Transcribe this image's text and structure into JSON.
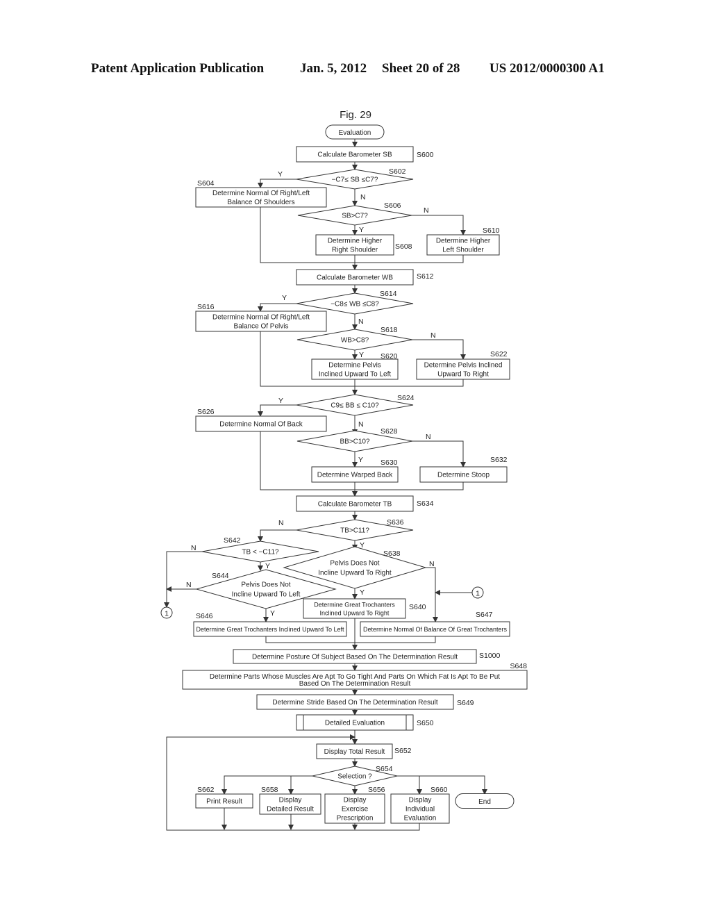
{
  "header": {
    "publication": "Patent Application Publication",
    "date": "Jan. 5, 2012",
    "sheet": "Sheet 20 of 28",
    "number": "US 2012/0000300 A1"
  },
  "figure": {
    "title": "Fig. 29",
    "start": "Evaluation",
    "end": "End",
    "connector": "1",
    "branch": {
      "yes": "Y",
      "no": "N"
    },
    "steps": {
      "S600": {
        "id": "S600",
        "lines": [
          "Calculate Barometer SB"
        ]
      },
      "S602": {
        "id": "S602",
        "lines": [
          "−C7≤ SB ≤C7?"
        ]
      },
      "S604": {
        "id": "S604",
        "lines": [
          "Determine Normal Of Right/Left",
          "Balance Of Shoulders"
        ]
      },
      "S606": {
        "id": "S606",
        "lines": [
          "SB>C7?"
        ]
      },
      "S608": {
        "id": "S608",
        "lines": [
          "Determine Higher",
          "Right Shoulder"
        ]
      },
      "S610": {
        "id": "S610",
        "lines": [
          "Determine Higher",
          "Left Shoulder"
        ]
      },
      "S612": {
        "id": "S612",
        "lines": [
          "Calculate Barometer WB"
        ]
      },
      "S614": {
        "id": "S614",
        "lines": [
          "−C8≤ WB ≤C8?"
        ]
      },
      "S616": {
        "id": "S616",
        "lines": [
          "Determine Normal Of Right/Left",
          "Balance Of Pelvis"
        ]
      },
      "S618": {
        "id": "S618",
        "lines": [
          "WB>C8?"
        ]
      },
      "S620": {
        "id": "S620",
        "lines": [
          "Determine Pelvis",
          "Inclined Upward To Left"
        ]
      },
      "S622": {
        "id": "S622",
        "lines": [
          "Determine Pelvis Inclined",
          "Upward To Right"
        ]
      },
      "S624": {
        "id": "S624",
        "lines": [
          "C9≤ BB ≤ C10?"
        ]
      },
      "S626": {
        "id": "S626",
        "lines": [
          "Determine Normal Of Back"
        ]
      },
      "S628": {
        "id": "S628",
        "lines": [
          "BB>C10?"
        ]
      },
      "S630": {
        "id": "S630",
        "lines": [
          "Determine Warped Back"
        ]
      },
      "S632": {
        "id": "S632",
        "lines": [
          "Determine Stoop"
        ]
      },
      "S634": {
        "id": "S634",
        "lines": [
          "Calculate Barometer TB"
        ]
      },
      "S636": {
        "id": "S636",
        "lines": [
          "TB>C11?"
        ]
      },
      "S638": {
        "id": "S638",
        "lines": [
          "Pelvis Does Not",
          "Incline Upward To Right"
        ]
      },
      "S640": {
        "id": "S640",
        "lines": [
          "Determine Great Trochanters",
          "Inclined Upward To Right"
        ]
      },
      "S642": {
        "id": "S642",
        "lines": [
          "TB < −C11?"
        ]
      },
      "S644": {
        "id": "S644",
        "lines": [
          "Pelvis Does Not",
          "Incline Upward To Left"
        ]
      },
      "S646": {
        "id": "S646",
        "lines": [
          "Determine Great Trochanters Inclined Upward To Left"
        ]
      },
      "S647": {
        "id": "S647",
        "lines": [
          "Determine Normal Of Balance Of Great Trochanters"
        ]
      },
      "S1000": {
        "id": "S1000",
        "lines": [
          "Determine Posture Of Subject Based On The Determination Result"
        ]
      },
      "S648": {
        "id": "S648",
        "lines": [
          "Determine Parts Whose Muscles Are Apt To Go Tight And Parts On Which Fat Is Apt To Be Put",
          "Based On The Determination Result"
        ]
      },
      "S649": {
        "id": "S649",
        "lines": [
          "Determine Stride Based On The Determination Result"
        ]
      },
      "S650": {
        "id": "S650",
        "lines": [
          "Detailed Evaluation"
        ]
      },
      "S652": {
        "id": "S652",
        "lines": [
          "Display Total Result"
        ]
      },
      "S654": {
        "id": "S654",
        "lines": [
          "Selection ?"
        ]
      },
      "S656": {
        "id": "S656",
        "lines": [
          "Display",
          "Exercise",
          "Prescription"
        ]
      },
      "S658": {
        "id": "S658",
        "lines": [
          "Display",
          "Detailed Result"
        ]
      },
      "S660": {
        "id": "S660",
        "lines": [
          "Display",
          "Individual",
          "Evaluation"
        ]
      },
      "S662": {
        "id": "S662",
        "lines": [
          "Print Result"
        ]
      }
    }
  }
}
